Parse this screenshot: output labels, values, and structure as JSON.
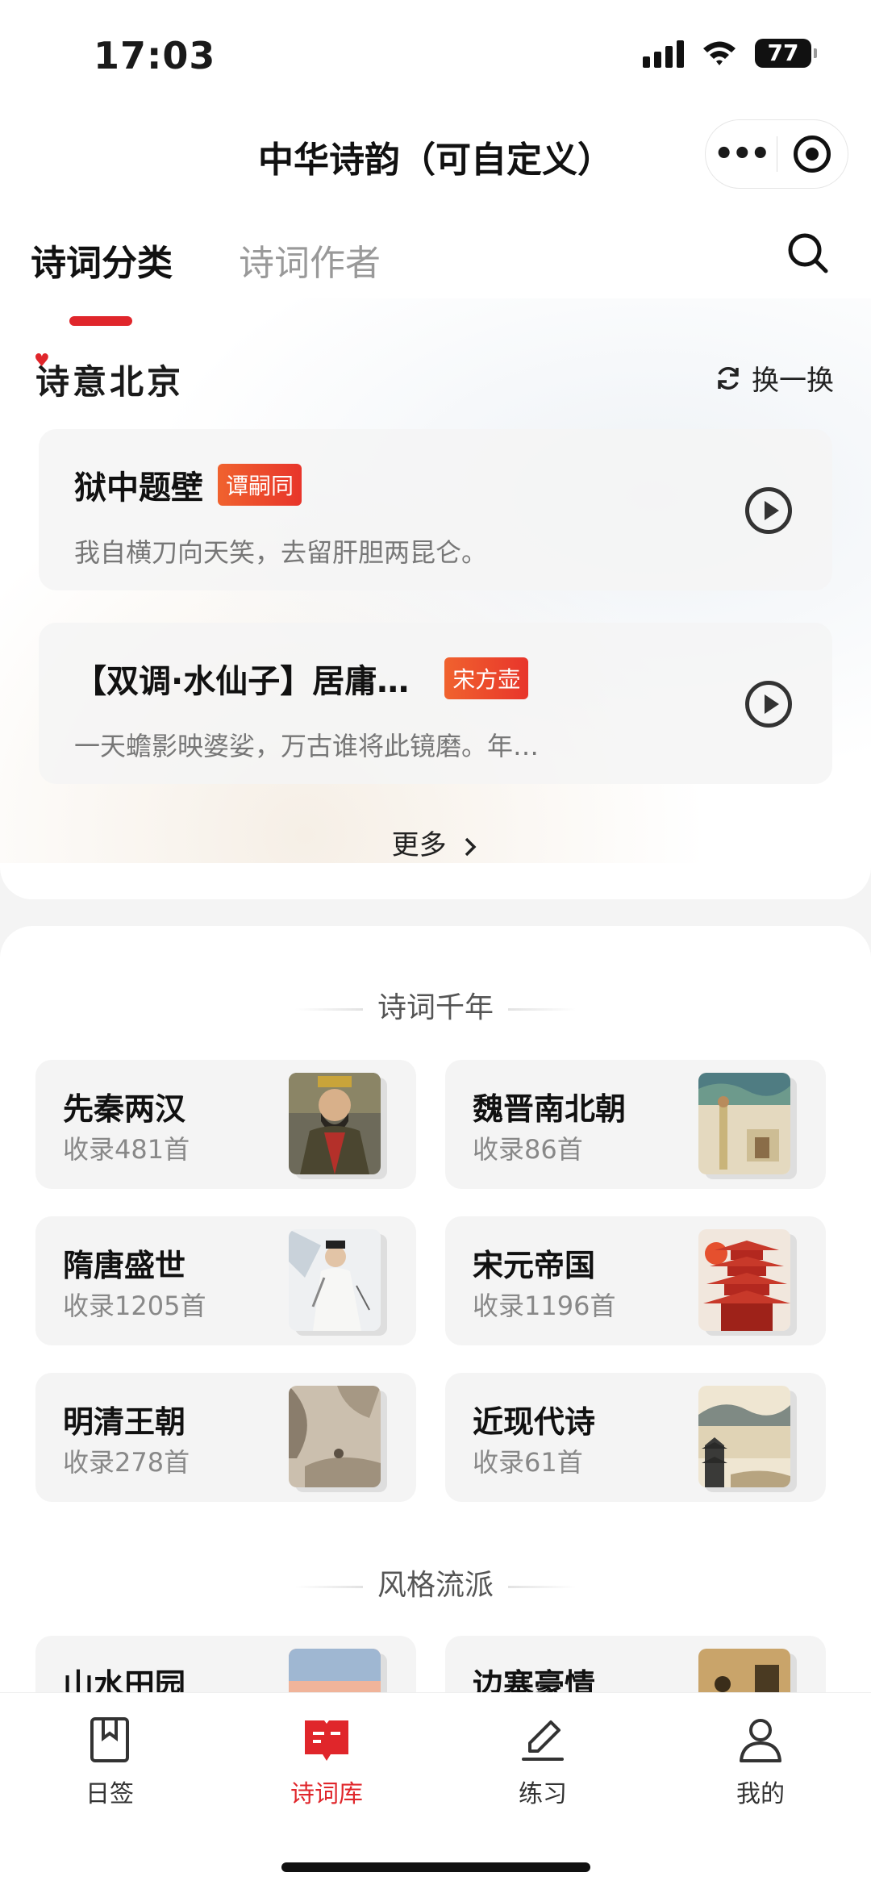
{
  "status": {
    "time": "17:03",
    "battery": "77"
  },
  "navbar": {
    "title": "中华诗韵（可自定义）"
  },
  "tabs": [
    {
      "label": "诗词分类"
    },
    {
      "label": "诗词作者"
    }
  ],
  "featured": {
    "title": "诗意北京",
    "refresh_label": "换一换",
    "poems": [
      {
        "title": "狱中题壁",
        "author": "谭嗣同",
        "excerpt": "我自横刀向天笑，去留肝胆两昆仑。"
      },
      {
        "title": "【双调·水仙子】居庸…",
        "author": "宋方壶",
        "excerpt": "一天蟾影映婆娑，万古谁将此镜磨。年…"
      }
    ],
    "more_label": "更多"
  },
  "eras": {
    "title": "诗词千年",
    "items": [
      {
        "name": "先秦两汉",
        "count": "收录481首"
      },
      {
        "name": "魏晋南北朝",
        "count": "收录86首"
      },
      {
        "name": "隋唐盛世",
        "count": "收录1205首"
      },
      {
        "name": "宋元帝国",
        "count": "收录1196首"
      },
      {
        "name": "明清王朝",
        "count": "收录278首"
      },
      {
        "name": "近现代诗",
        "count": "收录61首"
      }
    ]
  },
  "styles": {
    "title": "风格流派",
    "items": [
      {
        "name": "山水田园"
      },
      {
        "name": "边塞豪情"
      }
    ]
  },
  "tabbar": [
    {
      "label": "日签",
      "icon": "bookmark-icon"
    },
    {
      "label": "诗词库",
      "icon": "book-icon",
      "active": true
    },
    {
      "label": "练习",
      "icon": "pencil-icon"
    },
    {
      "label": "我的",
      "icon": "person-icon"
    }
  ],
  "colors": {
    "accent": "#e0262b",
    "tag_gradient": [
      "#f0622e",
      "#e8352b"
    ]
  }
}
